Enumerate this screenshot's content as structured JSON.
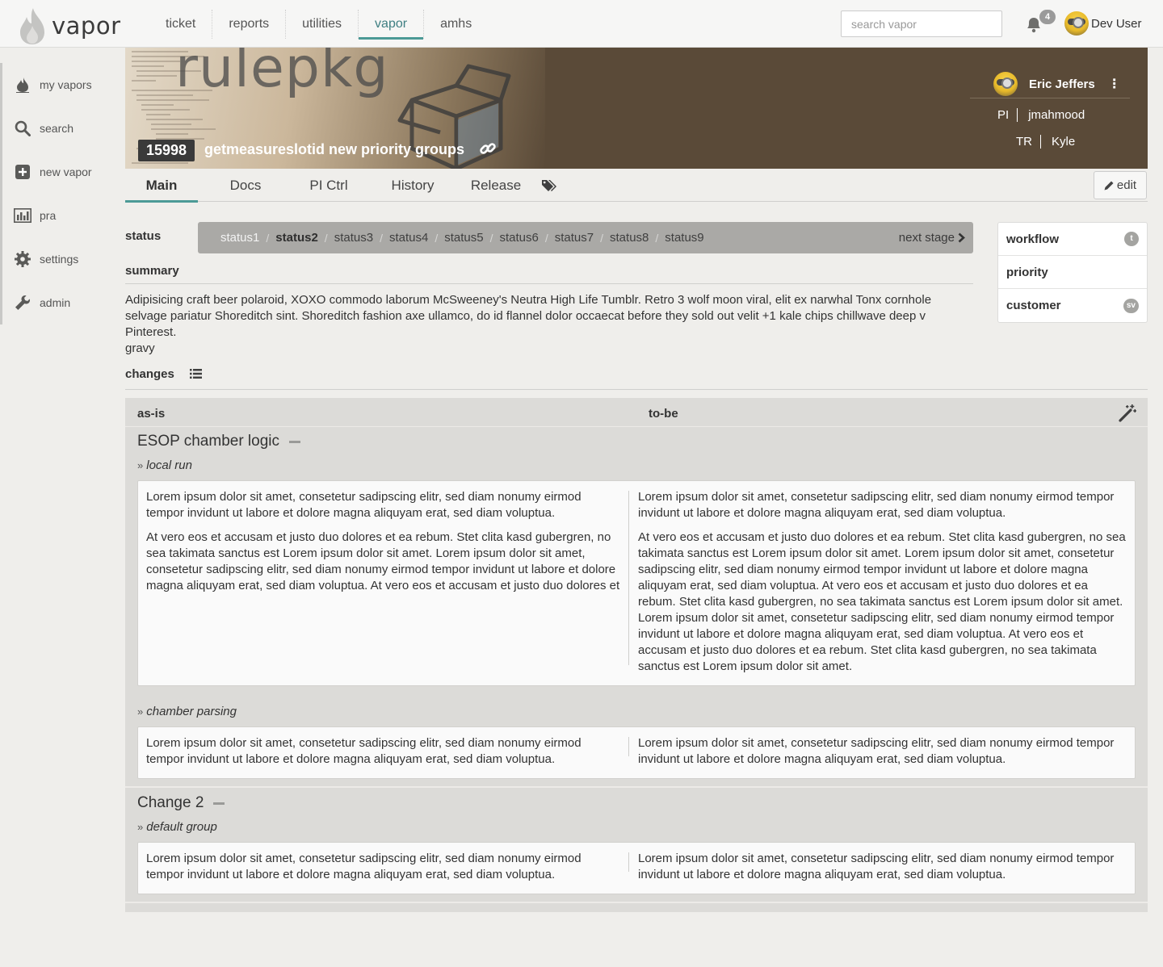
{
  "app": {
    "name": "vapor"
  },
  "topnav": {
    "items": [
      {
        "label": "ticket"
      },
      {
        "label": "reports"
      },
      {
        "label": "utilities"
      },
      {
        "label": "vapor"
      },
      {
        "label": "amhs"
      }
    ],
    "active": "vapor",
    "search_placeholder": "search vapor",
    "notifications_count": "4",
    "user_name": "Dev User"
  },
  "sidebar": {
    "items": [
      {
        "label": "my vapors",
        "icon": "flame-icon"
      },
      {
        "label": "search",
        "icon": "search-icon"
      },
      {
        "label": "new vapor",
        "icon": "plus-square-icon"
      },
      {
        "label": "pra",
        "icon": "bar-chart-icon"
      },
      {
        "label": "settings",
        "icon": "gear-icon"
      },
      {
        "label": "admin",
        "icon": "wrench-icon"
      }
    ]
  },
  "banner": {
    "background_text": "rulepkg",
    "id": "15998",
    "title": "getmeasureslotid new priority groups",
    "owner": "Eric Jeffers",
    "roles": [
      {
        "role": "PI",
        "name": "jmahmood"
      },
      {
        "role": "TR",
        "name": "Kyle"
      }
    ]
  },
  "tabs": {
    "items": [
      {
        "label": "Main"
      },
      {
        "label": "Docs"
      },
      {
        "label": "PI Ctrl"
      },
      {
        "label": "History"
      },
      {
        "label": "Release"
      }
    ],
    "active": "Main",
    "edit_label": "edit"
  },
  "status": {
    "label": "status",
    "stages": [
      "status1",
      "status2",
      "status3",
      "status4",
      "status5",
      "status6",
      "status7",
      "status8",
      "status9"
    ],
    "completed": [
      "status1"
    ],
    "current": "status2",
    "next_label": "next stage"
  },
  "summary": {
    "label": "summary",
    "text": "Adipisicing craft beer polaroid, XOXO commodo laborum McSweeney's Neutra High Life Tumblr. Retro 3 wolf moon viral, elit ex narwhal Tonx cornhole selvage pariatur Shoreditch sint. Shoreditch fashion axe ullamco, do id flannel dolor occaecat before they sold out velit +1 kale chips chillwave deep v Pinterest.",
    "extra": "gravy"
  },
  "right_panel": {
    "rows": [
      {
        "label": "workflow",
        "pill": "t"
      },
      {
        "label": "priority",
        "pill": ""
      },
      {
        "label": "customer",
        "pill": "sv"
      }
    ]
  },
  "changes": {
    "label": "changes",
    "as_is_label": "as-is",
    "to_be_label": "to-be",
    "groups": [
      {
        "title": "ESOP chamber logic",
        "subgroups": [
          {
            "title": "local run",
            "as_is": [
              "Lorem ipsum dolor sit amet, consetetur sadipscing elitr, sed diam nonumy eirmod tempor invidunt ut labore et dolore magna aliquyam erat, sed diam voluptua.",
              "At vero eos et accusam et justo duo dolores et ea rebum. Stet clita kasd gubergren, no sea takimata sanctus est Lorem ipsum dolor sit amet. Lorem ipsum dolor sit amet, consetetur sadipscing elitr, sed diam nonumy eirmod tempor invidunt ut labore et dolore magna aliquyam erat, sed diam voluptua. At vero eos et accusam et justo duo dolores et"
            ],
            "to_be": [
              "Lorem ipsum dolor sit amet, consetetur sadipscing elitr, sed diam nonumy eirmod tempor invidunt ut labore et dolore magna aliquyam erat, sed diam voluptua.",
              "At vero eos et accusam et justo duo dolores et ea rebum. Stet clita kasd gubergren, no sea takimata sanctus est Lorem ipsum dolor sit amet. Lorem ipsum dolor sit amet, consetetur sadipscing elitr, sed diam nonumy eirmod tempor invidunt ut labore et dolore magna aliquyam erat, sed diam voluptua. At vero eos et accusam et justo duo dolores et ea rebum. Stet clita kasd gubergren, no sea takimata sanctus est Lorem ipsum dolor sit amet. Lorem ipsum dolor sit amet, consetetur sadipscing elitr, sed diam nonumy eirmod tempor invidunt ut labore et dolore magna aliquyam erat, sed diam voluptua. At vero eos et accusam et justo duo dolores et ea rebum. Stet clita kasd gubergren, no sea takimata sanctus est Lorem ipsum dolor sit amet."
            ]
          },
          {
            "title": "chamber parsing",
            "as_is": [
              "Lorem ipsum dolor sit amet, consetetur sadipscing elitr, sed diam nonumy eirmod tempor invidunt ut labore et dolore magna aliquyam erat, sed diam voluptua."
            ],
            "to_be": [
              "Lorem ipsum dolor sit amet, consetetur sadipscing elitr, sed diam nonumy eirmod tempor invidunt ut labore et dolore magna aliquyam erat, sed diam voluptua."
            ]
          }
        ]
      },
      {
        "title": "Change 2",
        "subgroups": [
          {
            "title": "default group",
            "as_is": [
              "Lorem ipsum dolor sit amet, consetetur sadipscing elitr, sed diam nonumy eirmod tempor invidunt ut labore et dolore magna aliquyam erat, sed diam voluptua."
            ],
            "to_be": [
              "Lorem ipsum dolor sit amet, consetetur sadipscing elitr, sed diam nonumy eirmod tempor invidunt ut labore et dolore magna aliquyam erat, sed diam voluptua."
            ]
          }
        ]
      }
    ]
  },
  "colors": {
    "accent": "#4c9a96",
    "banner_bg": "#5a4a38",
    "status_bar": "#aaa9a6",
    "page_bg": "#efeeeb"
  }
}
